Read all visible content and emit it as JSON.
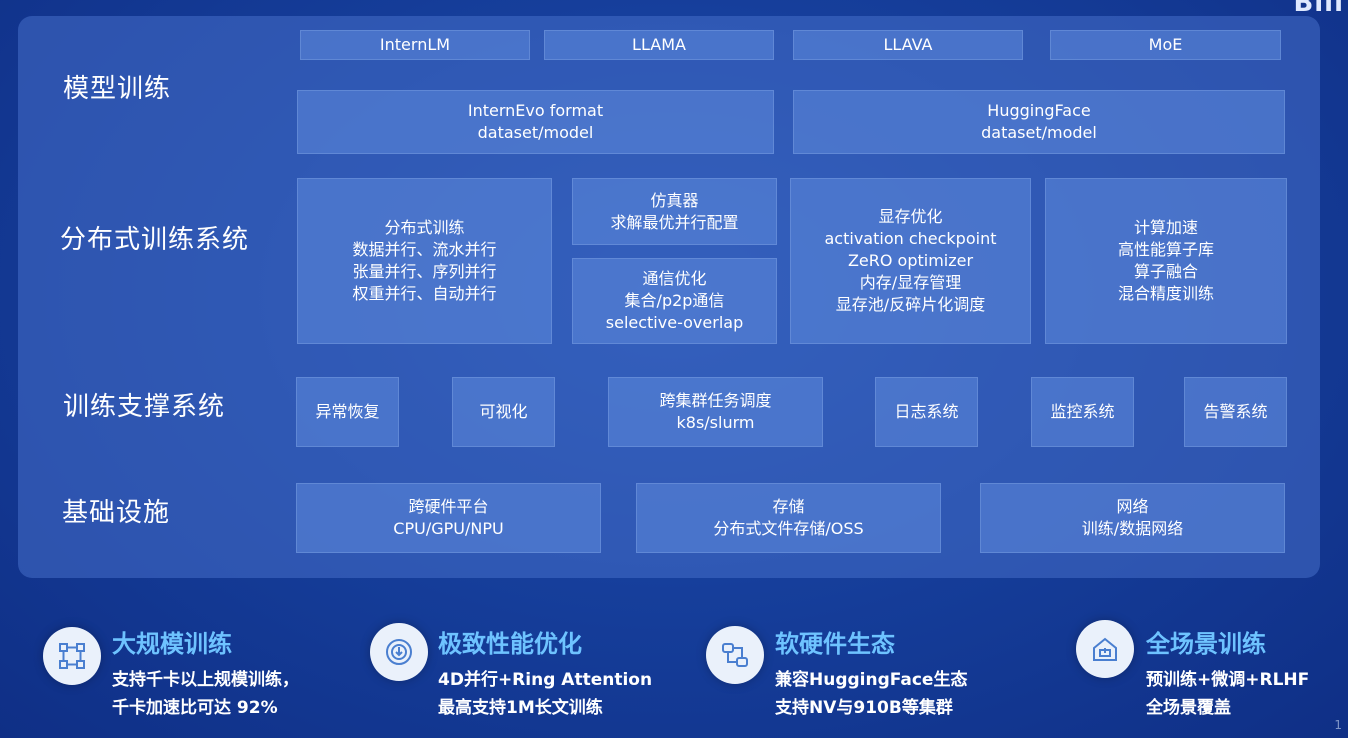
{
  "logo_fragment": "Bili",
  "rows": {
    "model_training": {
      "label": "模型训练",
      "models": [
        "InternLM",
        "LLAMA",
        "LLAVA",
        "MoE"
      ],
      "formats": [
        {
          "line1": "InternEvo format",
          "line2": "dataset/model"
        },
        {
          "line1": "HuggingFace",
          "line2": "dataset/model"
        }
      ]
    },
    "distributed": {
      "label": "分布式训练系统",
      "parallel": [
        "分布式训练",
        "数据并行、流水并行",
        "张量并行、序列并行",
        "权重并行、自动并行"
      ],
      "simulator": [
        "仿真器",
        "求解最优并行配置"
      ],
      "comm": [
        "通信优化",
        "集合/p2p通信",
        "selective-overlap"
      ],
      "memory": [
        "显存优化",
        "activation checkpoint",
        "ZeRO optimizer",
        "内存/显存管理",
        "显存池/反碎片化调度"
      ],
      "compute": [
        "计算加速",
        "高性能算子库",
        "算子融合",
        "混合精度训练"
      ]
    },
    "support": {
      "label": "训练支撑系统",
      "items": {
        "recovery": "异常恢复",
        "visual": "可视化",
        "sched_line1": "跨集群任务调度",
        "sched_line2": "k8s/slurm",
        "log": "日志系统",
        "monitor": "监控系统",
        "alert": "告警系统"
      }
    },
    "infra": {
      "label": "基础设施",
      "hw": {
        "line1": "跨硬件平台",
        "line2": "CPU/GPU/NPU"
      },
      "storage": {
        "line1": "存储",
        "line2": "分布式文件存储/OSS"
      },
      "network": {
        "line1": "网络",
        "line2": "训练/数据网络"
      }
    }
  },
  "features": [
    {
      "title": "大规模训练",
      "line1": "支持千卡以上规模训练，",
      "line2": "千卡加速比可达 92%",
      "icon": "network-nodes-icon"
    },
    {
      "title": "极致性能优化",
      "line1": "4D并行+Ring Attention",
      "line2": "最高支持1M长文训练",
      "icon": "speed-gauge-icon"
    },
    {
      "title": "软硬件生态",
      "line1": "兼容HuggingFace生态",
      "line2": "支持NV与910B等集群",
      "icon": "ecosystem-link-icon"
    },
    {
      "title": "全场景训练",
      "line1": "预训练+微调+RLHF",
      "line2": "全场景覆盖",
      "icon": "house-scene-icon"
    }
  ],
  "page_number": "1",
  "colors": {
    "feature_title": "#6ec3ff",
    "background": "#163f9c"
  }
}
